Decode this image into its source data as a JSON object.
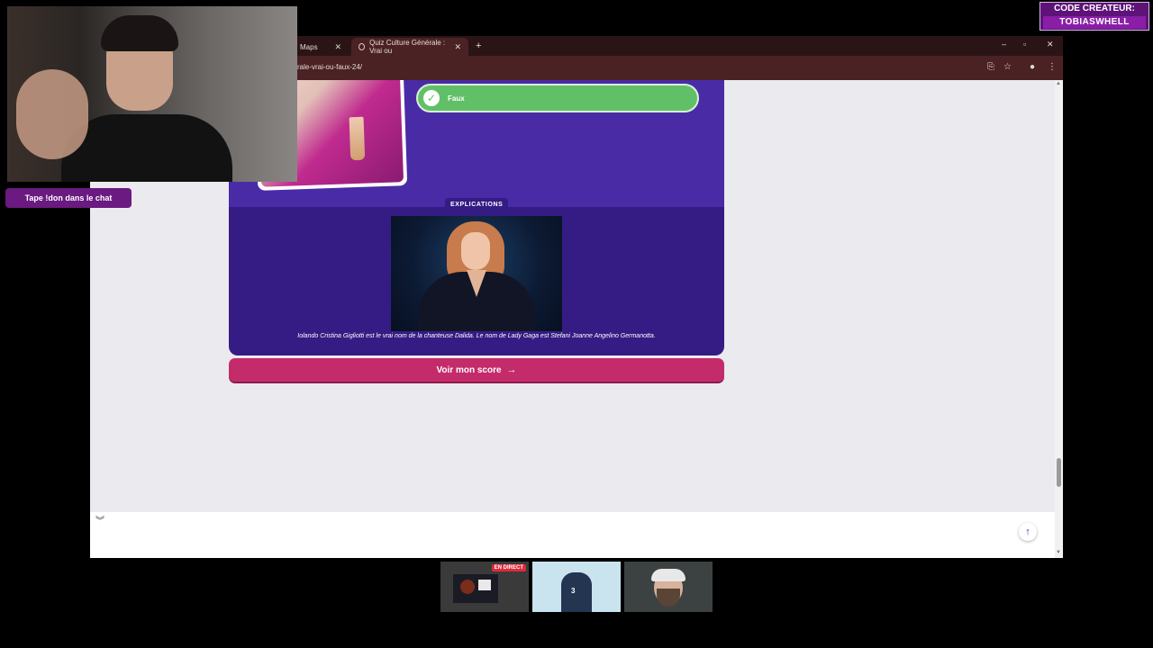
{
  "browser": {
    "tabs": [
      {
        "label": "Maps"
      },
      {
        "label": "Quiz Culture Générale : Vrai ou"
      }
    ],
    "url": "rale-vrai-ou-faux-24/"
  },
  "quiz": {
    "answer_label": "Faux",
    "explanations_tag": "EXPLICATIONS",
    "explanation_text": "Iolando Cristina Gigliotti est le vrai nom de la chanteuse Dalida. Le nom de Lady Gaga est Stefani Joanne Angelino Germanotta.",
    "score_button_label": "Voir mon score"
  },
  "overlay": {
    "chat_badge": "Tape !don dans le chat",
    "creator_line1": "CODE CREATEUR:",
    "creator_line2": "TOBIASWHELL"
  },
  "thumbnails": {
    "live_label": "EN DIRECT"
  },
  "colors": {
    "browser_frame": "#2b1416",
    "quiz_purple": "#4a2ba6",
    "quiz_dark_purple": "#341c84",
    "answer_green": "#61c067",
    "score_pink": "#c42b6a",
    "badge_purple": "#6a1a80"
  }
}
